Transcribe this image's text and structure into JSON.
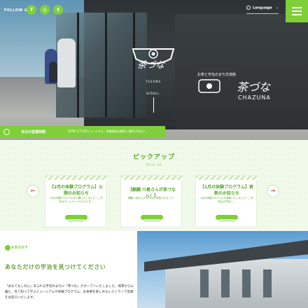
{
  "header": {
    "follow_label": "FOLLOW US!",
    "sns": [
      {
        "icon": "facebook-icon",
        "glyph": "f"
      },
      {
        "icon": "instagram-icon",
        "glyph": "◎"
      },
      {
        "icon": "twitter-icon",
        "glyph": "t"
      }
    ],
    "language_label": "Language",
    "accent_color": "#7fcf3a"
  },
  "hero": {
    "logo_text": "茶づな",
    "logo_sub": "TAZUNA",
    "scroll_label": "SCROLL",
    "sign_small": "お茶と宇治のまち交流館",
    "sign_main": "茶づな",
    "sign_latin": "CHAZUNA"
  },
  "hours": {
    "label": "本日の営業時間",
    "time": "9:00-17:00",
    "note": "ミュージアム・体験施設は最終入場16:30まで"
  },
  "pickup": {
    "title": "ピックアップ",
    "subtitle": "PICK UP",
    "cards": [
      {
        "title": "【2月の体験プログラム】公開のお知らせ",
        "desc": "2月の体験プログラムを公開いたしました！ご予約はホームページからどうぞ。"
      },
      {
        "title": "【麒麟 川島さんが茶づなへ！】",
        "desc": "麒麟 川島さんが茶づなに来館されました！"
      },
      {
        "title": "【1月の体験プログラム】更新のお知らせ",
        "desc": "1月の体験プログラムを更新いたしました！ご予約はお早めに。"
      }
    ],
    "prev_glyph": "←",
    "next_glyph": "→"
  },
  "about": {
    "label": "ABOUT",
    "heading": "あなただけの宇治を見つけてください",
    "body": "「おもてなしの心」あふれる宇治のまちに「茶づな」がオープンいたしました。抹茶から公園と、見て知って学ぶミュージアムや体験プログラム、お食事を楽しめるレストランで皆様をお迎えいたします。"
  }
}
